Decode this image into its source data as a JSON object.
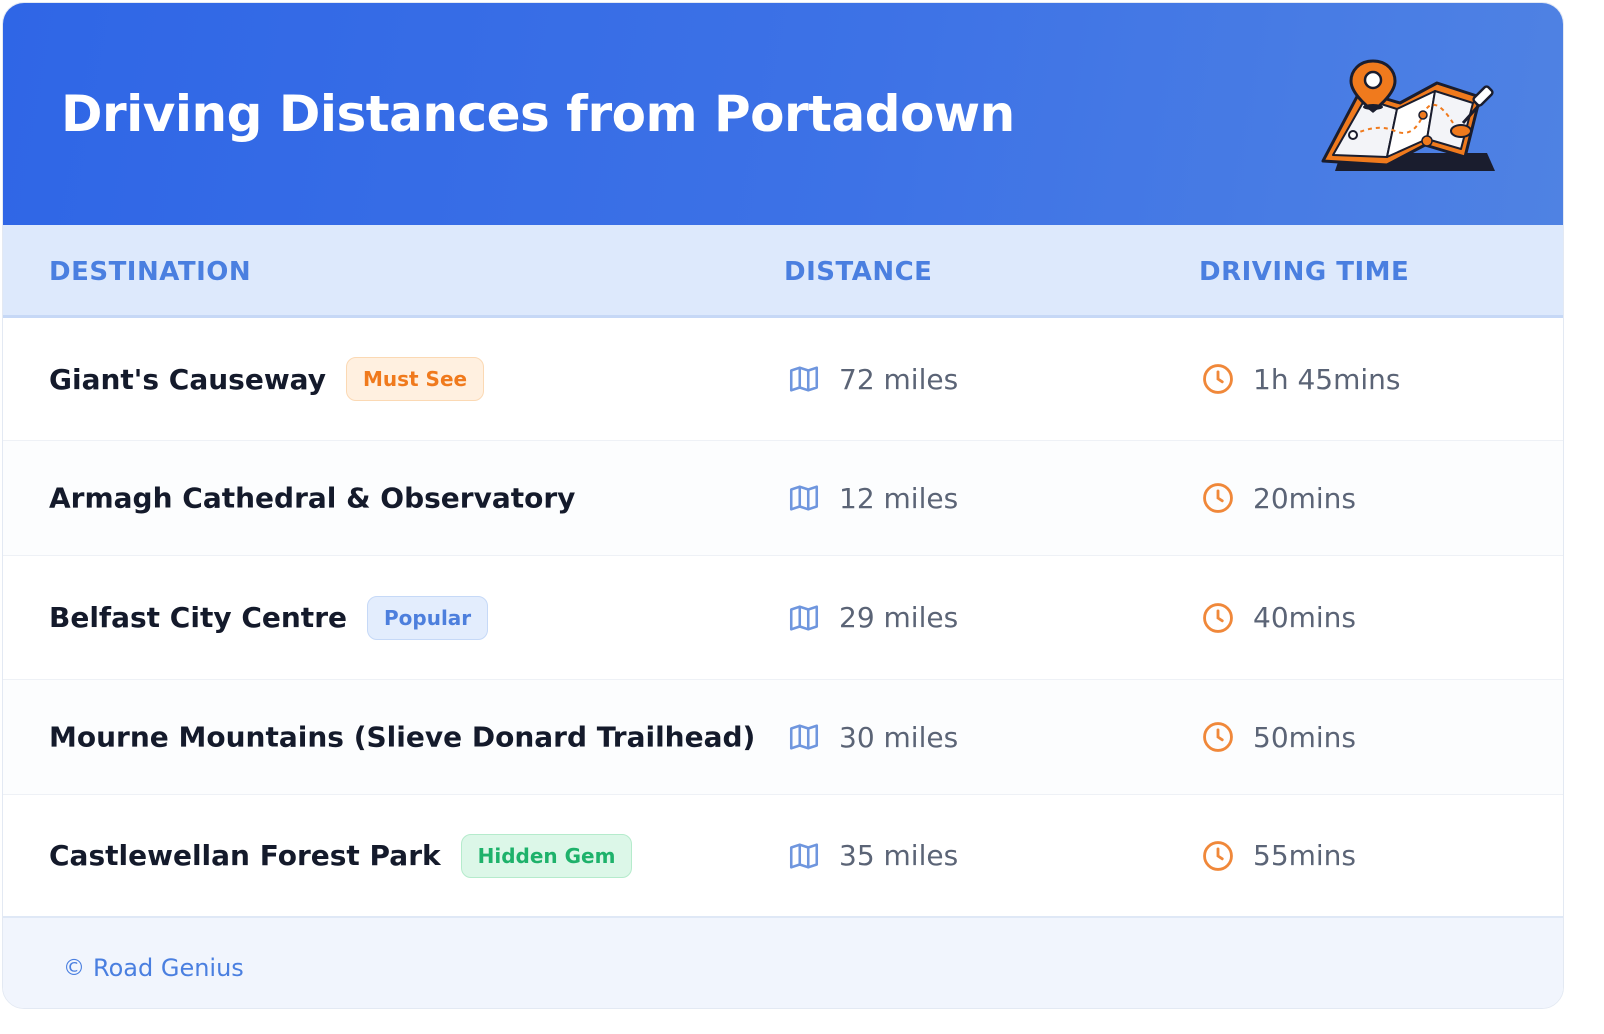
{
  "header": {
    "title": "Driving Distances from Portadown",
    "illustration_icon": "folded-map-with-pin-icon",
    "background_color": "#2f66e6"
  },
  "table": {
    "columns": [
      "DESTINATION",
      "DISTANCE",
      "DRIVING TIME"
    ],
    "distance_icon": "map-icon",
    "time_icon": "clock-icon",
    "rows": [
      {
        "destination": "Giant's Causeway",
        "badge": "Must See",
        "badge_color": "#f07a1d",
        "distance": "72 miles",
        "time": "1h 45mins"
      },
      {
        "destination": "Armagh Cathedral & Observatory",
        "badge": "",
        "distance": "12 miles",
        "time": "20mins"
      },
      {
        "destination": "Belfast City Centre",
        "badge": "Popular",
        "badge_color": "#4d7fdd",
        "distance": "29 miles",
        "time": "40mins"
      },
      {
        "destination": "Mourne Mountains (Slieve Donard Trailhead)",
        "badge": "",
        "distance": "30 miles",
        "time": "50mins"
      },
      {
        "destination": "Castlewellan Forest Park",
        "badge": "Hidden Gem",
        "badge_color": "#1eb26b",
        "distance": "35 miles",
        "time": "55mins"
      }
    ]
  },
  "footer": {
    "copyright_symbol": "©",
    "brand": "Road Genius"
  }
}
